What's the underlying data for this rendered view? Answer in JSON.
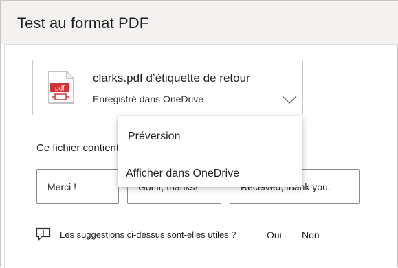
{
  "header": {
    "title": "Test au format PDF"
  },
  "attachment": {
    "filename": "clarks.pdf d’étiquette de retour",
    "location": "Enregistré dans OneDrive",
    "icon": "pdf-file-icon",
    "icon_text": "pdf",
    "accent_color": "#d13438"
  },
  "suggestion": {
    "text": "Ce fichier contient un fichier pdf"
  },
  "quick_replies": [
    {
      "label": "Merci !"
    },
    {
      "label": "Got it, thanks!"
    },
    {
      "label": "Received, thank you."
    }
  ],
  "feedback": {
    "question": "Les suggestions ci-dessus sont-elles utiles ?",
    "yes": "Oui",
    "no": "Non"
  },
  "menu": {
    "items": [
      {
        "label": "Préversion"
      },
      {
        "label": "Afficher dans OneDrive"
      }
    ]
  }
}
